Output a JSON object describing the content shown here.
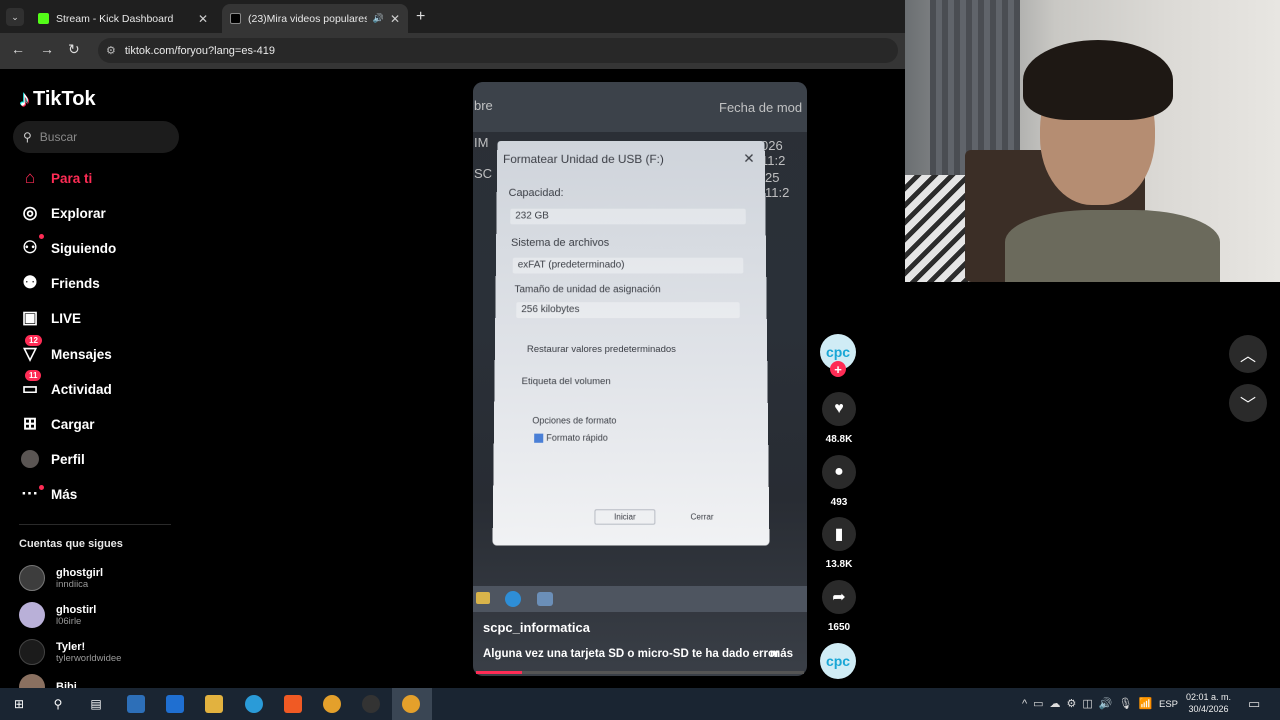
{
  "browser": {
    "tabs": [
      {
        "title": "Stream - Kick Dashboard",
        "fav_color": "#53fc18"
      },
      {
        "title": "(23)Mira videos populares de",
        "fav_color": "#000000"
      }
    ],
    "url": "tiktok.com/foryou?lang=es-419"
  },
  "tiktok": {
    "brand": "TikTok",
    "search_placeholder": "Buscar",
    "nav": [
      {
        "label": "Para ti",
        "icon": "home-icon"
      },
      {
        "label": "Explorar",
        "icon": "compass-icon"
      },
      {
        "label": "Siguiendo",
        "icon": "following-icon"
      },
      {
        "label": "Friends",
        "icon": "friends-icon"
      },
      {
        "label": "LIVE",
        "icon": "live-icon"
      },
      {
        "label": "Mensajes",
        "icon": "messages-icon",
        "badge": "12"
      },
      {
        "label": "Actividad",
        "icon": "activity-icon",
        "badge": "11"
      },
      {
        "label": "Cargar",
        "icon": "upload-icon"
      },
      {
        "label": "Perfil",
        "icon": "profile-avatar"
      },
      {
        "label": "Más",
        "icon": "more-icon"
      }
    ],
    "following_title": "Cuentas que sigues",
    "following": [
      {
        "name": "ghostgirl",
        "handle": "inndiica"
      },
      {
        "name": "ghostirl",
        "handle": "l06irle"
      },
      {
        "name": "Tyler!",
        "handle": "tylerworldwidee"
      },
      {
        "name": "Bibi",
        "handle": ""
      }
    ],
    "video": {
      "creator": "scpc_informatica",
      "caption": "Alguna vez una tarjeta SD o micro-SD te ha dado error",
      "more": "más",
      "avatar_text": "cpc",
      "progress": 0.14,
      "scene": {
        "header_left": "bre",
        "header_right": "Fecha de mod",
        "side_1": "IM",
        "side_2": "SC",
        "date_1": "026 11:2",
        "date_2": "25 11:2",
        "dialog_title": "Formatear Unidad de USB (F:)",
        "capacity_label": "Capacidad:",
        "capacity_value": "232 GB",
        "fs_label": "Sistema de archivos",
        "fs_value": "exFAT (predeterminado)",
        "alloc_label": "Tamaño de unidad de asignación",
        "alloc_value": "256 kilobytes",
        "restore": "Restaurar valores predeterminados",
        "volume_label": "Etiqueta del volumen",
        "format_options": "Opciones de formato",
        "quick_format": "Formato rápido",
        "start": "Iniciar",
        "close": "Cerrar"
      }
    },
    "actions": {
      "likes": "48.8K",
      "comments": "493",
      "saves": "13.8K",
      "shares": "1650"
    }
  },
  "taskbar": {
    "lang": "ESP",
    "time": "02:01 a. m.",
    "date": "30/4/2026"
  }
}
